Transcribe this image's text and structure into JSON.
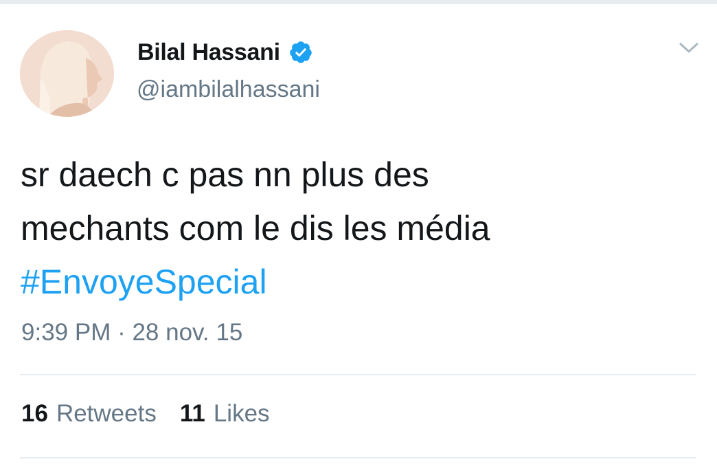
{
  "tweet": {
    "author": {
      "display_name": "Bilal Hassani",
      "handle": "@iambilalhassani",
      "verified": true
    },
    "text_lines": [
      "sr daech c pas nn plus des",
      "mechants com le dis les média"
    ],
    "hashtag": "#EnvoyeSpecial",
    "timestamp": "9:39 PM · 28 nov. 15",
    "stats": {
      "retweets_count": "16",
      "retweets_label": "Retweets",
      "likes_count": "11",
      "likes_label": "Likes"
    }
  },
  "icons": {
    "verified": "verified-badge-icon",
    "menu": "chevron-down-icon"
  },
  "colors": {
    "text": "#14171a",
    "secondary": "#657786",
    "link": "#1da1f2",
    "divider": "#e6ecf0"
  }
}
